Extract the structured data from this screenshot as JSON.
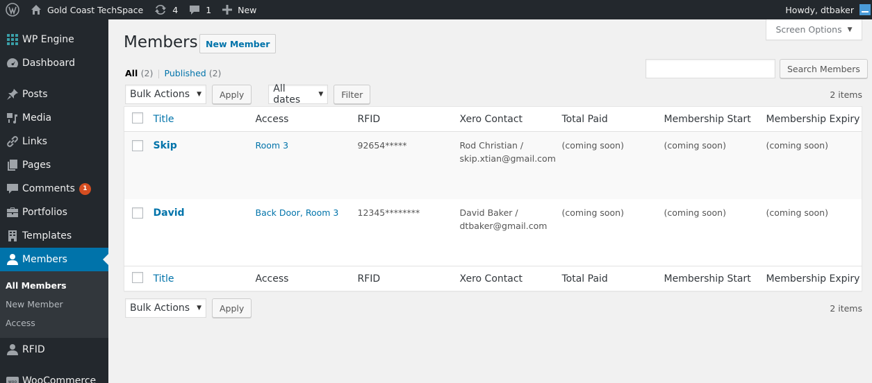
{
  "adminbar": {
    "wp_logo_icon": "wordpress-logo-icon",
    "site_name": "Gold Coast TechSpace",
    "updates_count": "4",
    "comments_count": "1",
    "new_label": "New",
    "howdy": "Howdy, dtbaker"
  },
  "sidebar": {
    "items": [
      {
        "label": "WP Engine",
        "icon": "wp-engine-icon"
      },
      {
        "label": "Dashboard",
        "icon": "dashboard-icon"
      },
      {
        "label": "Posts",
        "icon": "pin-icon"
      },
      {
        "label": "Media",
        "icon": "media-icon"
      },
      {
        "label": "Links",
        "icon": "link-icon"
      },
      {
        "label": "Pages",
        "icon": "pages-icon"
      },
      {
        "label": "Comments",
        "icon": "comment-icon",
        "badge": "1"
      },
      {
        "label": "Portfolios",
        "icon": "portfolio-icon"
      },
      {
        "label": "Templates",
        "icon": "templates-icon"
      },
      {
        "label": "Members",
        "icon": "user-icon",
        "current": true
      },
      {
        "label": "RFID",
        "icon": "user-icon"
      },
      {
        "label": "WooCommerce",
        "icon": "woo-icon"
      }
    ],
    "submenu": [
      {
        "label": "All Members",
        "active": true
      },
      {
        "label": "New Member"
      },
      {
        "label": "Access"
      }
    ]
  },
  "screen_options": "Screen Options",
  "page": {
    "title": "Members",
    "add_new": "New Member"
  },
  "views": {
    "all": "All",
    "all_count": "(2)",
    "published": "Published",
    "published_count": "(2)",
    "separator": "|"
  },
  "search": {
    "value": "",
    "button": "Search Members"
  },
  "tablenav": {
    "bulk_actions": "Bulk Actions",
    "apply": "Apply",
    "dates": "All dates",
    "filter": "Filter",
    "items_count": "2 items"
  },
  "table": {
    "columns": [
      "Title",
      "Access",
      "RFID",
      "Xero Contact",
      "Total Paid",
      "Membership Start",
      "Membership Expiry"
    ],
    "rows": [
      {
        "title": "Skip",
        "access": "Room 3",
        "rfid": "92654*****",
        "xero_name": "Rod Christian /",
        "xero_email": "skip.xtian@gmail.com",
        "total_paid": "(coming soon)",
        "start": "(coming soon)",
        "expiry": "(coming soon)"
      },
      {
        "title": "David",
        "access": "Back Door, Room 3",
        "rfid": "12345********",
        "xero_name": "David Baker /",
        "xero_email": "dtbaker@gmail.com",
        "total_paid": "(coming soon)",
        "start": "(coming soon)",
        "expiry": "(coming soon)"
      }
    ]
  },
  "colors": {
    "accent": "#0073aa",
    "sidebar_bg": "#23282d",
    "badge": "#d54e21"
  }
}
